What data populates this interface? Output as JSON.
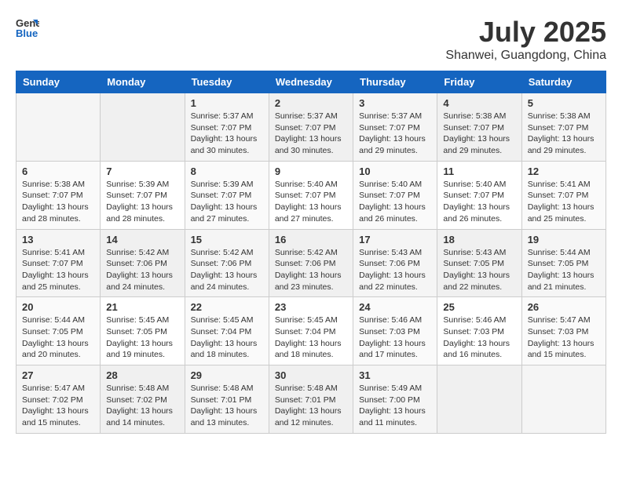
{
  "header": {
    "logo_line1": "General",
    "logo_line2": "Blue",
    "month": "July 2025",
    "location": "Shanwei, Guangdong, China"
  },
  "weekdays": [
    "Sunday",
    "Monday",
    "Tuesday",
    "Wednesday",
    "Thursday",
    "Friday",
    "Saturday"
  ],
  "weeks": [
    [
      {
        "day": "",
        "info": ""
      },
      {
        "day": "",
        "info": ""
      },
      {
        "day": "1",
        "info": "Sunrise: 5:37 AM\nSunset: 7:07 PM\nDaylight: 13 hours\nand 30 minutes."
      },
      {
        "day": "2",
        "info": "Sunrise: 5:37 AM\nSunset: 7:07 PM\nDaylight: 13 hours\nand 30 minutes."
      },
      {
        "day": "3",
        "info": "Sunrise: 5:37 AM\nSunset: 7:07 PM\nDaylight: 13 hours\nand 29 minutes."
      },
      {
        "day": "4",
        "info": "Sunrise: 5:38 AM\nSunset: 7:07 PM\nDaylight: 13 hours\nand 29 minutes."
      },
      {
        "day": "5",
        "info": "Sunrise: 5:38 AM\nSunset: 7:07 PM\nDaylight: 13 hours\nand 29 minutes."
      }
    ],
    [
      {
        "day": "6",
        "info": "Sunrise: 5:38 AM\nSunset: 7:07 PM\nDaylight: 13 hours\nand 28 minutes."
      },
      {
        "day": "7",
        "info": "Sunrise: 5:39 AM\nSunset: 7:07 PM\nDaylight: 13 hours\nand 28 minutes."
      },
      {
        "day": "8",
        "info": "Sunrise: 5:39 AM\nSunset: 7:07 PM\nDaylight: 13 hours\nand 27 minutes."
      },
      {
        "day": "9",
        "info": "Sunrise: 5:40 AM\nSunset: 7:07 PM\nDaylight: 13 hours\nand 27 minutes."
      },
      {
        "day": "10",
        "info": "Sunrise: 5:40 AM\nSunset: 7:07 PM\nDaylight: 13 hours\nand 26 minutes."
      },
      {
        "day": "11",
        "info": "Sunrise: 5:40 AM\nSunset: 7:07 PM\nDaylight: 13 hours\nand 26 minutes."
      },
      {
        "day": "12",
        "info": "Sunrise: 5:41 AM\nSunset: 7:07 PM\nDaylight: 13 hours\nand 25 minutes."
      }
    ],
    [
      {
        "day": "13",
        "info": "Sunrise: 5:41 AM\nSunset: 7:07 PM\nDaylight: 13 hours\nand 25 minutes."
      },
      {
        "day": "14",
        "info": "Sunrise: 5:42 AM\nSunset: 7:06 PM\nDaylight: 13 hours\nand 24 minutes."
      },
      {
        "day": "15",
        "info": "Sunrise: 5:42 AM\nSunset: 7:06 PM\nDaylight: 13 hours\nand 24 minutes."
      },
      {
        "day": "16",
        "info": "Sunrise: 5:42 AM\nSunset: 7:06 PM\nDaylight: 13 hours\nand 23 minutes."
      },
      {
        "day": "17",
        "info": "Sunrise: 5:43 AM\nSunset: 7:06 PM\nDaylight: 13 hours\nand 22 minutes."
      },
      {
        "day": "18",
        "info": "Sunrise: 5:43 AM\nSunset: 7:05 PM\nDaylight: 13 hours\nand 22 minutes."
      },
      {
        "day": "19",
        "info": "Sunrise: 5:44 AM\nSunset: 7:05 PM\nDaylight: 13 hours\nand 21 minutes."
      }
    ],
    [
      {
        "day": "20",
        "info": "Sunrise: 5:44 AM\nSunset: 7:05 PM\nDaylight: 13 hours\nand 20 minutes."
      },
      {
        "day": "21",
        "info": "Sunrise: 5:45 AM\nSunset: 7:05 PM\nDaylight: 13 hours\nand 19 minutes."
      },
      {
        "day": "22",
        "info": "Sunrise: 5:45 AM\nSunset: 7:04 PM\nDaylight: 13 hours\nand 18 minutes."
      },
      {
        "day": "23",
        "info": "Sunrise: 5:45 AM\nSunset: 7:04 PM\nDaylight: 13 hours\nand 18 minutes."
      },
      {
        "day": "24",
        "info": "Sunrise: 5:46 AM\nSunset: 7:03 PM\nDaylight: 13 hours\nand 17 minutes."
      },
      {
        "day": "25",
        "info": "Sunrise: 5:46 AM\nSunset: 7:03 PM\nDaylight: 13 hours\nand 16 minutes."
      },
      {
        "day": "26",
        "info": "Sunrise: 5:47 AM\nSunset: 7:03 PM\nDaylight: 13 hours\nand 15 minutes."
      }
    ],
    [
      {
        "day": "27",
        "info": "Sunrise: 5:47 AM\nSunset: 7:02 PM\nDaylight: 13 hours\nand 15 minutes."
      },
      {
        "day": "28",
        "info": "Sunrise: 5:48 AM\nSunset: 7:02 PM\nDaylight: 13 hours\nand 14 minutes."
      },
      {
        "day": "29",
        "info": "Sunrise: 5:48 AM\nSunset: 7:01 PM\nDaylight: 13 hours\nand 13 minutes."
      },
      {
        "day": "30",
        "info": "Sunrise: 5:48 AM\nSunset: 7:01 PM\nDaylight: 13 hours\nand 12 minutes."
      },
      {
        "day": "31",
        "info": "Sunrise: 5:49 AM\nSunset: 7:00 PM\nDaylight: 13 hours\nand 11 minutes."
      },
      {
        "day": "",
        "info": ""
      },
      {
        "day": "",
        "info": ""
      }
    ]
  ]
}
